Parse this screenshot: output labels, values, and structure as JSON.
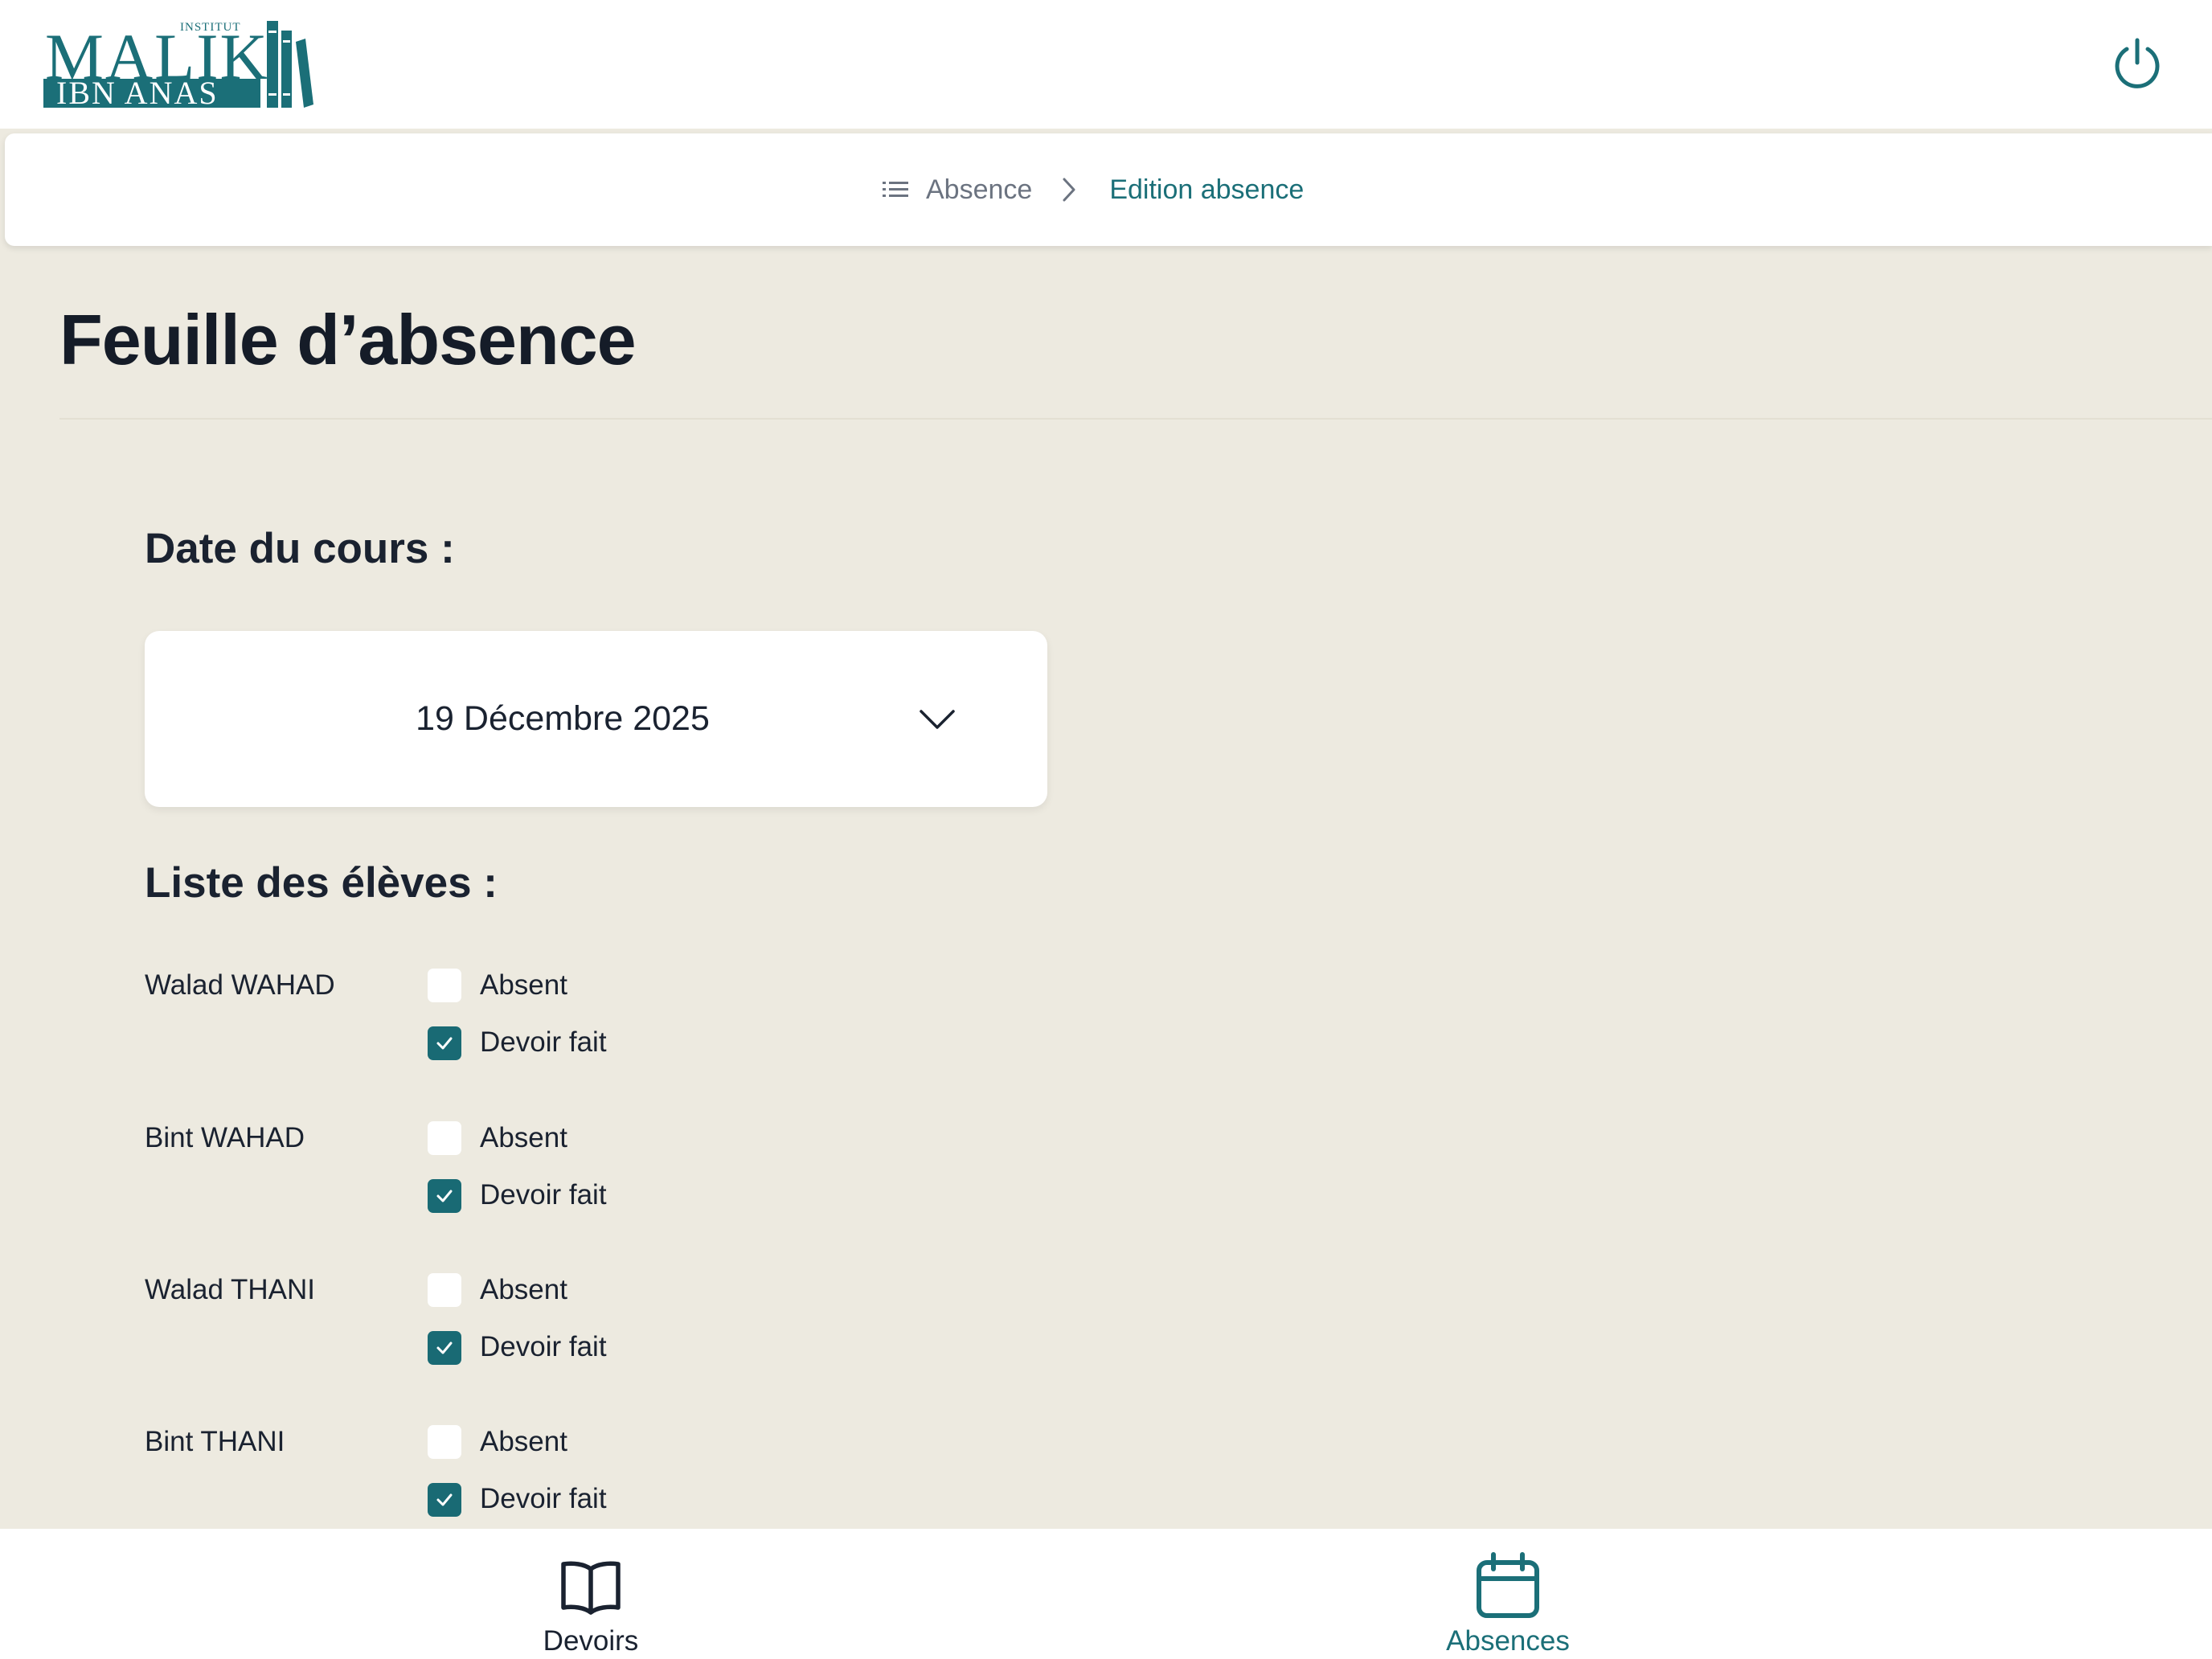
{
  "header": {
    "logo": {
      "small_text": "INSTITUT",
      "main_text": "MALIK",
      "sub_text": "IBN ANAS"
    },
    "power_icon": "power-icon"
  },
  "breadcrumb": {
    "home_icon": "list-icon",
    "home_label": "Absence",
    "separator_icon": "chevron-right-icon",
    "current_label": "Edition absence"
  },
  "page": {
    "title": "Feuille d’absence"
  },
  "date_section": {
    "label": "Date du cours :",
    "selected": "19 Décembre 2025",
    "chevron_icon": "chevron-down-icon"
  },
  "students_section": {
    "label": "Liste des élèves :",
    "absent_label": "Absent",
    "devoir_label": "Devoir fait",
    "students": [
      {
        "name": "Walad WAHAD",
        "absent": false,
        "devoir_fait": true
      },
      {
        "name": "Bint WAHAD",
        "absent": false,
        "devoir_fait": true
      },
      {
        "name": "Walad THANI",
        "absent": false,
        "devoir_fait": true
      },
      {
        "name": "Bint THANI",
        "absent": false,
        "devoir_fait": true
      }
    ]
  },
  "bottom_nav": {
    "items": [
      {
        "label": "Devoirs",
        "icon": "book-icon",
        "active": false
      },
      {
        "label": "Absences",
        "icon": "calendar-icon",
        "active": true
      }
    ]
  },
  "colors": {
    "accent": "#1b6f78",
    "checkbox_checked": "#196a74",
    "background": "#edeae0",
    "surface": "#ffffff",
    "text": "#1a2230",
    "muted": "#6b7380"
  }
}
